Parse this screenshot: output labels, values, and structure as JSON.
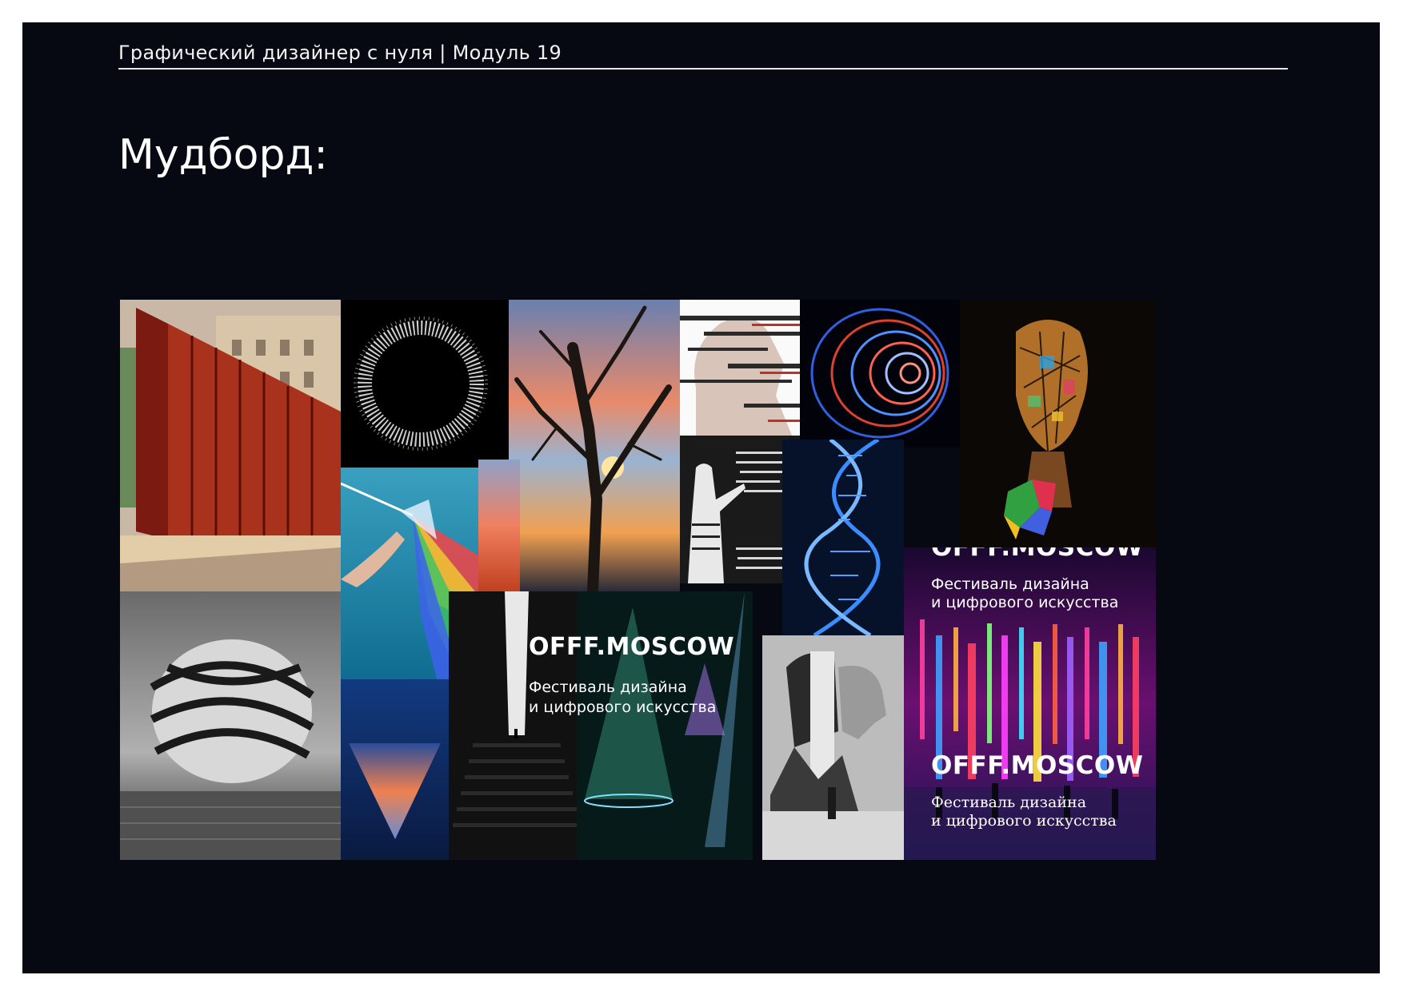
{
  "header": {
    "course": "Графический дизайнер с нуля | Модуль 19"
  },
  "title": "Мудборд:",
  "posters": [
    {
      "title": "OFFF.MOSCOW",
      "line1": "Фестиваль дизайна",
      "line2": "и  цифрового искусства"
    },
    {
      "title": "OFFF.MOSCOW",
      "line1": "Фестиваль дизайна",
      "line2": "и  цифрового искусства"
    },
    {
      "title": "OFFF.MOSCOW",
      "line1": "Фестиваль дизайна",
      "line2": "и  цифрового искусства"
    }
  ],
  "colors": {
    "background": "#070912",
    "text": "#ffffff",
    "frame": "#ffffff"
  }
}
